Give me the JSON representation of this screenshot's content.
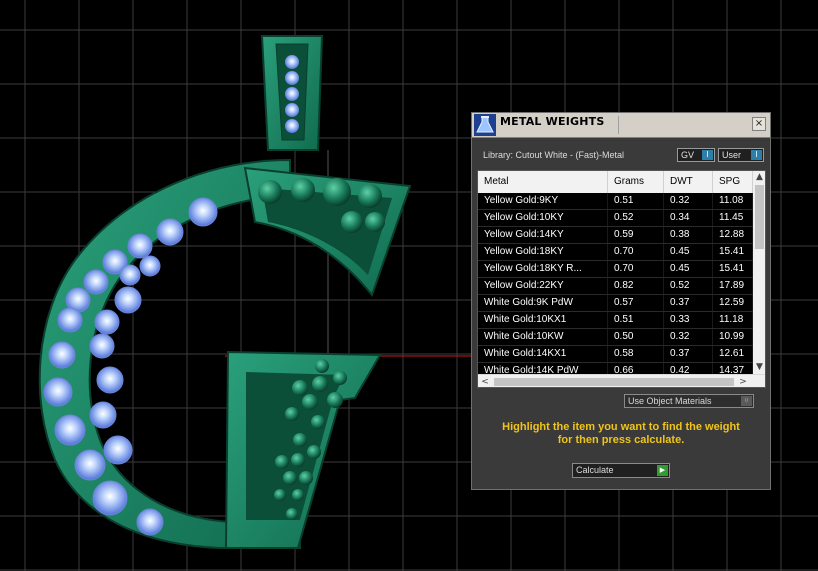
{
  "window": {
    "title": "METAL WEIGHTS",
    "close_label": "×"
  },
  "library_label": "Library: Cutout White - (Fast)-Metal",
  "toggles": {
    "gv_label": "GV",
    "user_label": "User",
    "knob_glyph": "I"
  },
  "table": {
    "headers": [
      "Metal",
      "Grams",
      "DWT",
      "SPG"
    ],
    "rows": [
      {
        "metal": "Yellow Gold:9KY",
        "grams": "0.51",
        "dwt": "0.32",
        "spg": "11.08"
      },
      {
        "metal": "Yellow Gold:10KY",
        "grams": "0.52",
        "dwt": "0.34",
        "spg": "11.45"
      },
      {
        "metal": "Yellow Gold:14KY",
        "grams": "0.59",
        "dwt": "0.38",
        "spg": "12.88"
      },
      {
        "metal": "Yellow Gold:18KY",
        "grams": "0.70",
        "dwt": "0.45",
        "spg": "15.41"
      },
      {
        "metal": "Yellow Gold:18KY R...",
        "grams": "0.70",
        "dwt": "0.45",
        "spg": "15.41"
      },
      {
        "metal": "Yellow Gold:22KY",
        "grams": "0.82",
        "dwt": "0.52",
        "spg": "17.89"
      },
      {
        "metal": "White Gold:9K PdW",
        "grams": "0.57",
        "dwt": "0.37",
        "spg": "12.59"
      },
      {
        "metal": "White Gold:10KX1",
        "grams": "0.51",
        "dwt": "0.33",
        "spg": "11.18"
      },
      {
        "metal": "White Gold:10KW",
        "grams": "0.50",
        "dwt": "0.32",
        "spg": "10.99"
      },
      {
        "metal": "White Gold:14KX1",
        "grams": "0.58",
        "dwt": "0.37",
        "spg": "12.61"
      },
      {
        "metal": "White Gold:14K PdW",
        "grams": "0.66",
        "dwt": "0.42",
        "spg": "14.37"
      }
    ],
    "scroll_up": "▲",
    "scroll_down": "▼",
    "scroll_left": "<",
    "scroll_right": ">"
  },
  "material_select": {
    "value": "Use Object Materials",
    "arrow": "○"
  },
  "instructions": {
    "line1": "Highlight the item you want to find the weight",
    "line2": "for then press calculate."
  },
  "calculate": {
    "label": "Calculate",
    "icon": "▶"
  },
  "colors": {
    "viewport_bg": "#000000",
    "grid": "#3c3c3c",
    "axis_red": "#c81e1e",
    "metal_green": "#1f8a6a",
    "gem_blue": "#8fb4ff",
    "instruction_yellow": "#f0c419",
    "toggle_blue": "#2e7fa8"
  },
  "icons": {
    "title": "metal-weights-flask-icon"
  }
}
